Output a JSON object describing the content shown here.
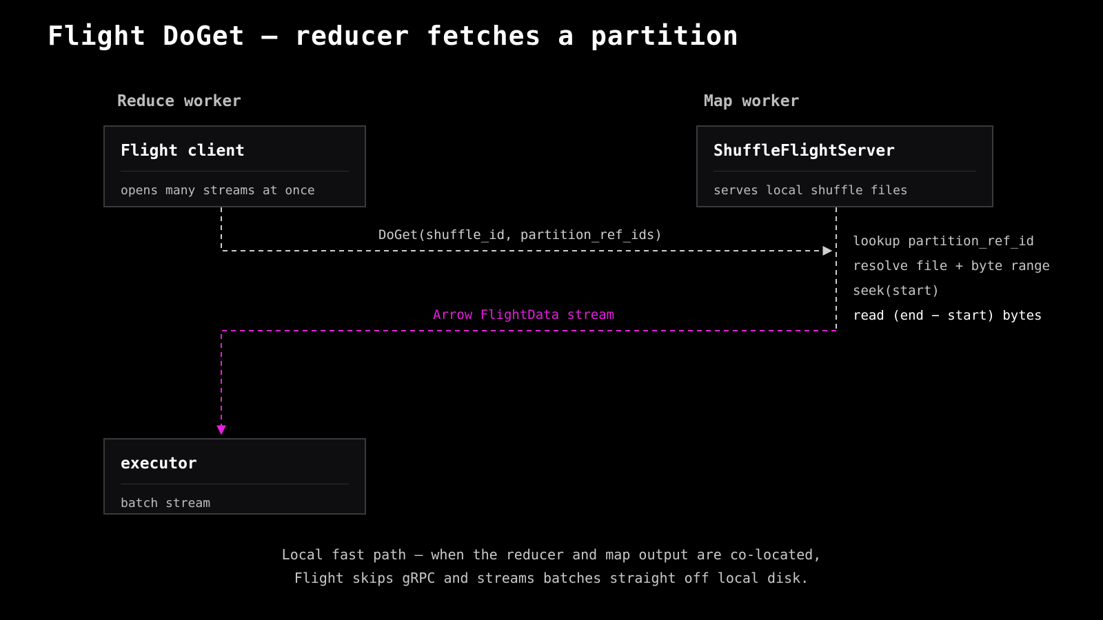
{
  "title": "Flight DoGet — reducer fetches a partition",
  "colors": {
    "background": "#000000",
    "box_fill": "#0e0e10",
    "box_border": "#3a3a3c",
    "request_line": "#cfcfcf",
    "stream_line": "#e91ee0"
  },
  "lanes": {
    "reduce": "Reduce worker",
    "map": "Map worker"
  },
  "nodes": {
    "flight_client": {
      "title": "Flight client",
      "subtitle": "opens many streams at once"
    },
    "server": {
      "title": "ShuffleFlightServer",
      "subtitle": "serves local shuffle files"
    },
    "executor": {
      "title": "executor",
      "subtitle": "batch stream"
    }
  },
  "messages": {
    "request": "DoGet(shuffle_id, partition_ref_ids)",
    "response": "Arrow FlightData stream"
  },
  "server_steps": [
    "lookup partition_ref_id",
    "resolve file + byte range",
    "seek(start)",
    "read (end − start) bytes"
  ],
  "footer": {
    "line1": "Local fast path — when the reducer and map output are co-located,",
    "line2": "Flight skips gRPC and streams batches straight off local disk."
  }
}
